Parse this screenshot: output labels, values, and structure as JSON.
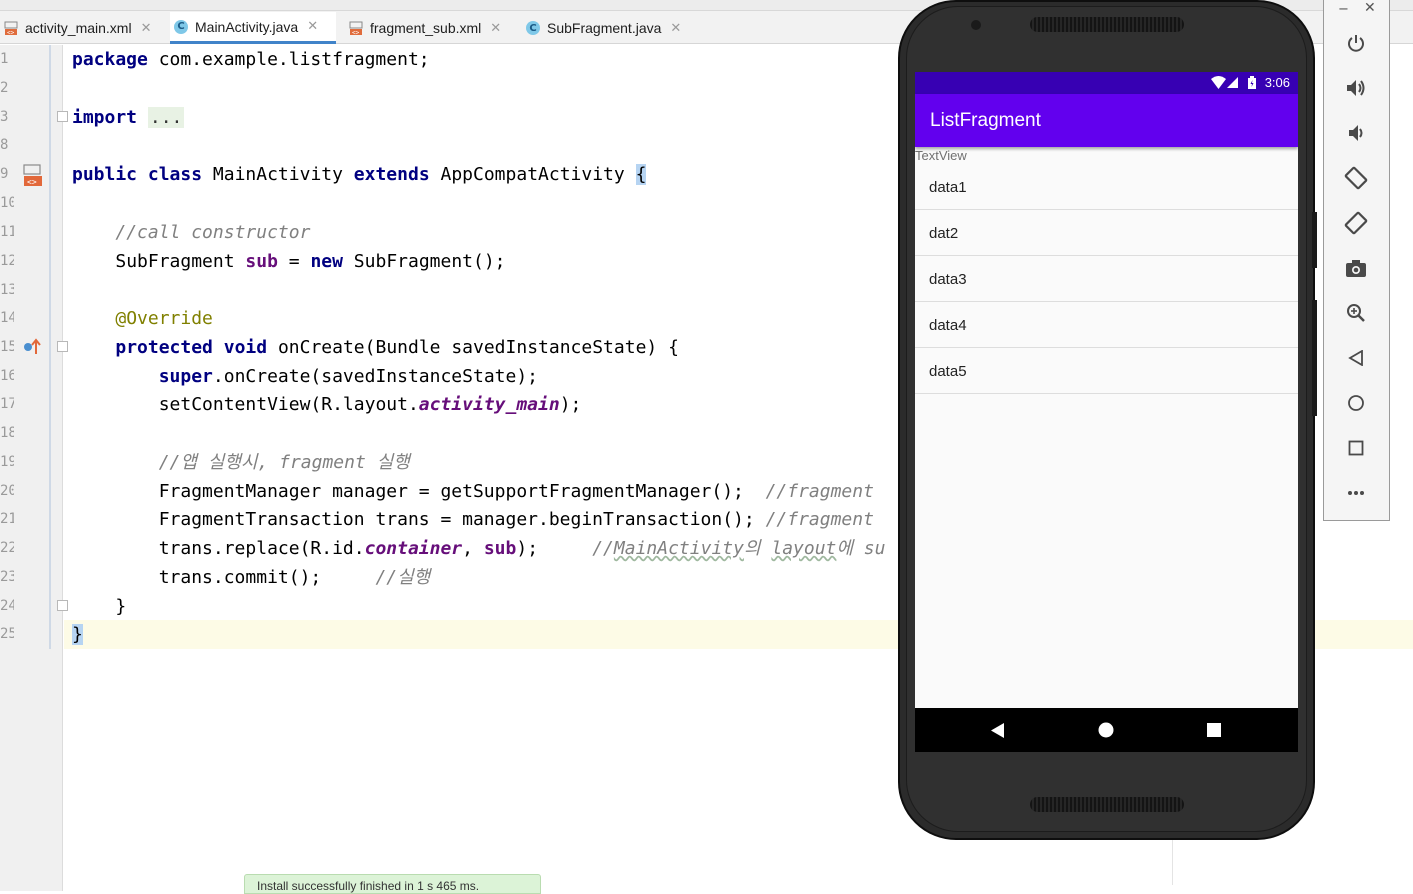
{
  "tabs": [
    {
      "label": "activity_main.xml",
      "active": false,
      "kind": "xml"
    },
    {
      "label": "MainActivity.java",
      "active": true,
      "kind": "class"
    },
    {
      "label": "fragment_sub.xml",
      "active": false,
      "kind": "xml"
    },
    {
      "label": "SubFragment.java",
      "active": false,
      "kind": "class"
    }
  ],
  "tab_close": "✕",
  "class_icon_letter": "C",
  "line_numbers": [
    "1",
    "2",
    "3",
    "8",
    "9",
    "10",
    "11",
    "12",
    "13",
    "14",
    "15",
    "16",
    "17",
    "18",
    "19",
    "20",
    "21",
    "22",
    "23",
    "24",
    "25"
  ],
  "code": {
    "l1_kw": "package",
    "l1_rest": " com.example.listfragment;",
    "l3_kw": "import",
    "l3_fold": "...",
    "l9_kw1": "public",
    "l9_kw2": "class",
    "l9_name": "MainActivity",
    "l9_kw3": "extends",
    "l9_super": "AppCompatActivity",
    "l9_brace": "{",
    "l11_comment": "//call constructor",
    "l12_type": "SubFragment",
    "l12_field": "sub",
    "l12_eq": " = ",
    "l12_kw": "new",
    "l12_rest": " SubFragment();",
    "l14_annotation": "@Override",
    "l15_kw1": "protected",
    "l15_kw2": "void",
    "l15_rest": " onCreate(Bundle savedInstanceState) {",
    "l16_kw": "super",
    "l16_rest": ".onCreate(savedInstanceState);",
    "l17_pre": "setContentView(R.layout.",
    "l17_field": "activity_main",
    "l17_post": ");",
    "l19_comment": "//앱 실행시, fragment 실행",
    "l20_code": "FragmentManager manager = getSupportFragmentManager();  ",
    "l20_comment": "//fragment",
    "l21_code": "FragmentTransaction trans = manager.beginTransaction(); ",
    "l21_comment": "//fragment",
    "l22_pre": "trans.replace(R.id.",
    "l22_field1": "container",
    "l22_mid": ", ",
    "l22_field2": "sub",
    "l22_post": ");     ",
    "l22_c1": "//",
    "l22_c2": "MainActivity",
    "l22_c3": "의 ",
    "l22_c4": "layout",
    "l22_c5": "에 su",
    "l23_code": "trans.commit();     ",
    "l23_comment": "//실행",
    "l24_brace": "}",
    "l25_brace": "}"
  },
  "toast_text": "Install successfully finished in 1 s 465 ms.",
  "emulator": {
    "status_time": "3:06",
    "app_title": "ListFragment",
    "textview_label": "TextView",
    "items": [
      "data1",
      "dat2",
      "data3",
      "data4",
      "data5"
    ],
    "window_min": "−",
    "window_close": "✕"
  },
  "toolbar_icons": [
    "power-icon",
    "volume-up-icon",
    "volume-down-icon",
    "rotate-left-icon",
    "rotate-right-icon",
    "camera-icon",
    "zoom-icon",
    "back-icon",
    "home-icon",
    "overview-icon",
    "more-icon"
  ],
  "colors": {
    "app_bar": "#6200ee",
    "status_bar": "#3700b3",
    "keyword": "#000080",
    "comment": "#808080",
    "annotation": "#808000",
    "field": "#660e7a",
    "tab_underline": "#4083c9"
  }
}
